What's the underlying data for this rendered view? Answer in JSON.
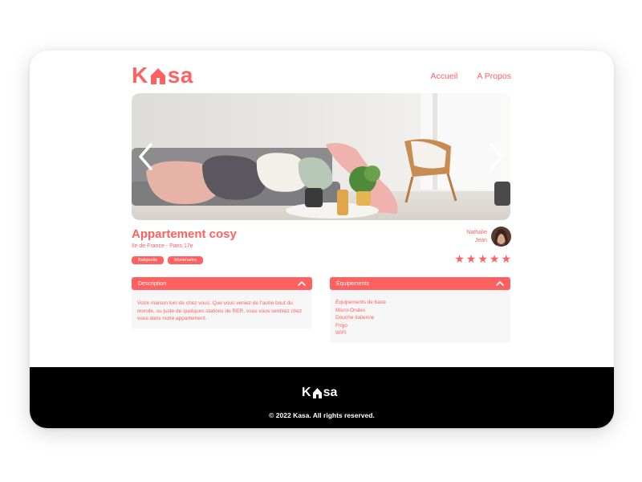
{
  "brand": {
    "logo_left": "K",
    "logo_right": "sa",
    "accent": "#FF6060"
  },
  "nav": {
    "items": [
      {
        "label": "Accueil"
      },
      {
        "label": "A Propos"
      }
    ]
  },
  "gallery": {
    "prev_icon": "chevron-left-icon",
    "next_icon": "chevron-right-icon"
  },
  "listing": {
    "title": "Appartement cosy",
    "location": "Ile de France - Paris 17e",
    "tags": [
      "Batignolle",
      "Montmartre"
    ],
    "host": {
      "first_name": "Nathalie",
      "last_name": "Jean"
    },
    "rating": 5,
    "star_char": "★"
  },
  "description": {
    "label": "Description",
    "text": "Votre maison loin de chez vous. Que vous veniez de l'autre bout du monde, ou juste de quelques stations de RER, vous vous sentirez chez vous dans notre appartement."
  },
  "equipments": {
    "label": "Équipements",
    "items": [
      "Équipements de base",
      "Micro-Ondes",
      "Douche italienne",
      "Frigo",
      "WIFI"
    ]
  },
  "footer": {
    "logo_left": "K",
    "logo_right": "sa",
    "copyright": "© 2022 Kasa. All rights reserved."
  }
}
